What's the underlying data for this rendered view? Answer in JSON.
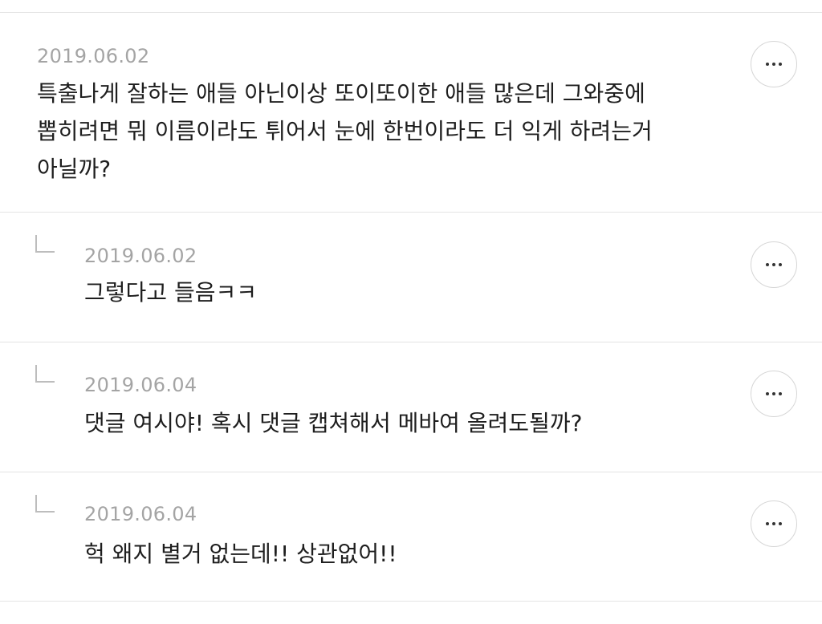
{
  "comments": [
    {
      "date": "2019.06.02",
      "lines": [
        "특출나게 잘하는 애들 아닌이상 또이또이한 애들 많은데 그와중에",
        "뽑히려면 뭐 이름이라도 튀어서 눈에 한번이라도 더 익게 하려는거",
        "아닐까?"
      ],
      "is_reply": false
    },
    {
      "date": "2019.06.02",
      "lines": [
        "그렇다고 들음ㅋㅋ"
      ],
      "is_reply": true
    },
    {
      "date": "2019.06.04",
      "lines": [
        "댓글 여시야! 혹시 댓글 캡쳐해서 메바여 올려도될까?"
      ],
      "is_reply": true
    },
    {
      "date": "2019.06.04",
      "lines": [
        "헉 왜지 별거 없는데!! 상관없어!!"
      ],
      "is_reply": true
    }
  ],
  "icons": {
    "more": "more-horizontal-icon",
    "reply": "reply-arrow-icon"
  },
  "colors": {
    "divider": "#e4e4e4",
    "date": "#a4a4a4",
    "text": "#1e1e1e",
    "button_border": "#d6d6d6"
  }
}
